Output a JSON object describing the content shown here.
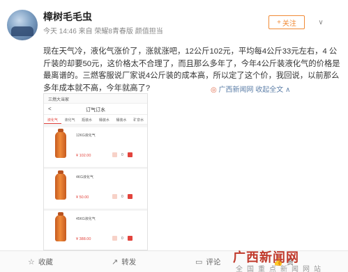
{
  "user": {
    "name": "樟树毛毛虫",
    "meta": "今天 14:46 来自 荣耀8青春版 颜值担当"
  },
  "actions": {
    "follow_icon": "+",
    "follow": "关注",
    "more_icon": "chevron-down-icon",
    "more_glyph": "∨"
  },
  "post": {
    "text": "现在天气冷，液化气涨价了，涨就涨吧，12公斤102元，平均每4公斤33元左右，4 公斤装的却要50元，这价格太不合理了，而且那么多年了，今年4公斤装液化气的价格是最离谱的。三燃客服说厂家说4公斤装的成本高，所以定了这个价，我回说，以前那么多年成本就不高，今年就高了?",
    "source_pin": "◎",
    "source": "广西新闻网",
    "collapse": "收起全文",
    "collapse_glyph": "∧"
  },
  "embed": {
    "app_name": "三燃大当家",
    "back": "<",
    "title": "订气订水",
    "tabs": [
      "液化气",
      "液化气",
      "瓶装水",
      "桶装水",
      "桶装水",
      "矿泉水"
    ],
    "products": [
      {
        "name": "12KG液化气",
        "price": "¥ 102.00",
        "qty": "0"
      },
      {
        "name": "4KG液化气",
        "price": "¥ 50.00",
        "qty": "0"
      },
      {
        "name": "45KG液化气",
        "price": "¥ 388.00",
        "qty": "0"
      }
    ]
  },
  "footer": {
    "collect_icon": "☆",
    "collect": "收藏",
    "share_icon": "↗",
    "share": "转发",
    "comment_icon": "▭",
    "comment": "评论",
    "like_icon": "👍",
    "like": "赞"
  },
  "watermark": {
    "main": "广西新闻网",
    "sub": "全国重点新闻网站"
  },
  "colors": {
    "accent": "#f08a35",
    "link": "#5d7fa8",
    "price": "#e2443d"
  }
}
